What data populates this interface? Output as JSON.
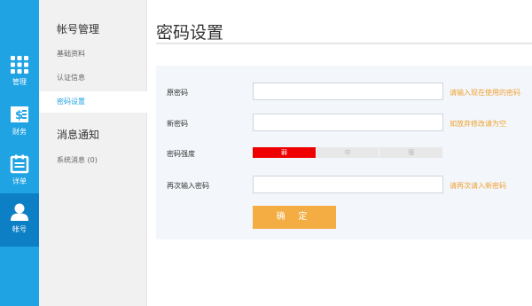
{
  "rail": {
    "items": [
      {
        "label": "管理",
        "icon": "grid-icon"
      },
      {
        "label": "财务",
        "icon": "finance-icon"
      },
      {
        "label": "详单",
        "icon": "list-icon"
      },
      {
        "label": "帐号",
        "icon": "user-icon",
        "active": true
      }
    ],
    "color": "#1fa3e3",
    "active_color": "#0d7fc4"
  },
  "subnav": {
    "account_heading": "帐号管理",
    "account_items": [
      {
        "label": "基础资料"
      },
      {
        "label": "认证信息"
      },
      {
        "label": "密码设置",
        "active": true
      }
    ],
    "message_heading": "消息通知",
    "message_items": [
      {
        "label": "系统消息 (0)"
      }
    ]
  },
  "main": {
    "title": "密码设置",
    "form": {
      "old_password": {
        "label": "原密码",
        "value": "",
        "hint": "请输入现在使用的密码"
      },
      "new_password": {
        "label": "新密码",
        "value": "",
        "hint": "如放弃修改请为空"
      },
      "strength": {
        "label": "密码强度",
        "weak": "弱",
        "medium": "中",
        "strong": "强",
        "current": "弱"
      },
      "repeat_password": {
        "label": "再次输入密码",
        "value": "",
        "hint": "请再次请入新密码"
      },
      "submit_label": "确 定"
    },
    "accent_hint_color": "#f0a030",
    "button_color": "#f3ad43"
  }
}
